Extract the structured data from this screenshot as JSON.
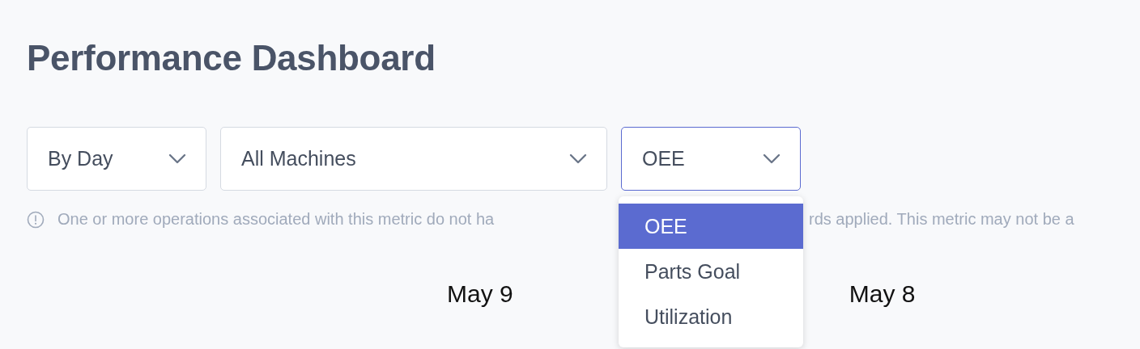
{
  "title": "Performance Dashboard",
  "filters": [
    {
      "value": "By Day",
      "focused": false
    },
    {
      "value": "All Machines",
      "focused": false
    },
    {
      "value": "OEE",
      "focused": true
    }
  ],
  "notice": {
    "before": "One or more operations associated with this metric do not ha",
    "after": "rds applied. This metric may not be a"
  },
  "menu": {
    "options": [
      {
        "label": "OEE",
        "selected": true
      },
      {
        "label": "Parts Goal",
        "selected": false
      },
      {
        "label": "Utilization",
        "selected": false
      }
    ]
  },
  "date_labels": [
    "May 9",
    "May 8"
  ]
}
